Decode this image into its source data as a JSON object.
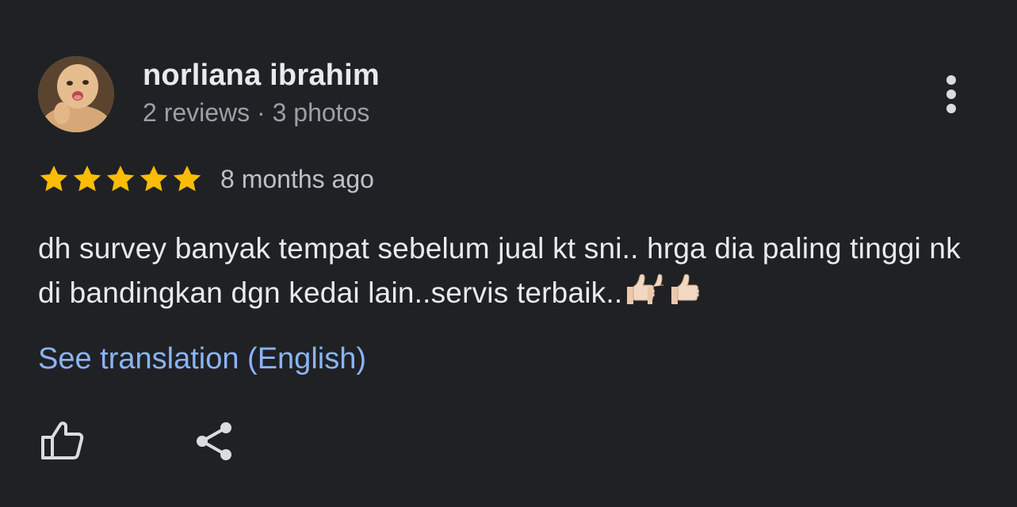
{
  "reviewer": {
    "name": "norliana ibrahim",
    "meta": "2 reviews · 3 photos",
    "avatar_icon": "baby-photo-avatar"
  },
  "more_icon": "vertical-dots-icon",
  "rating": {
    "stars": 5,
    "max": 5,
    "star_color": "#fbbc04",
    "time": "8 months ago"
  },
  "review": {
    "text": "dh survey banyak tempat sebelum jual kt sni.. hrga dia paling tinggi nk di bandingkan dgn kedai lain..servis terbaik..",
    "trailing_emoji": "thumbs-up-emoji"
  },
  "translate_link": "See translation (English)",
  "actions": {
    "like_icon": "thumbs-up-icon",
    "share_icon": "share-icon"
  },
  "colors": {
    "background": "#202124",
    "primary_text": "#e8eaed",
    "secondary_text": "#9aa0a6",
    "link": "#8ab4f8"
  }
}
